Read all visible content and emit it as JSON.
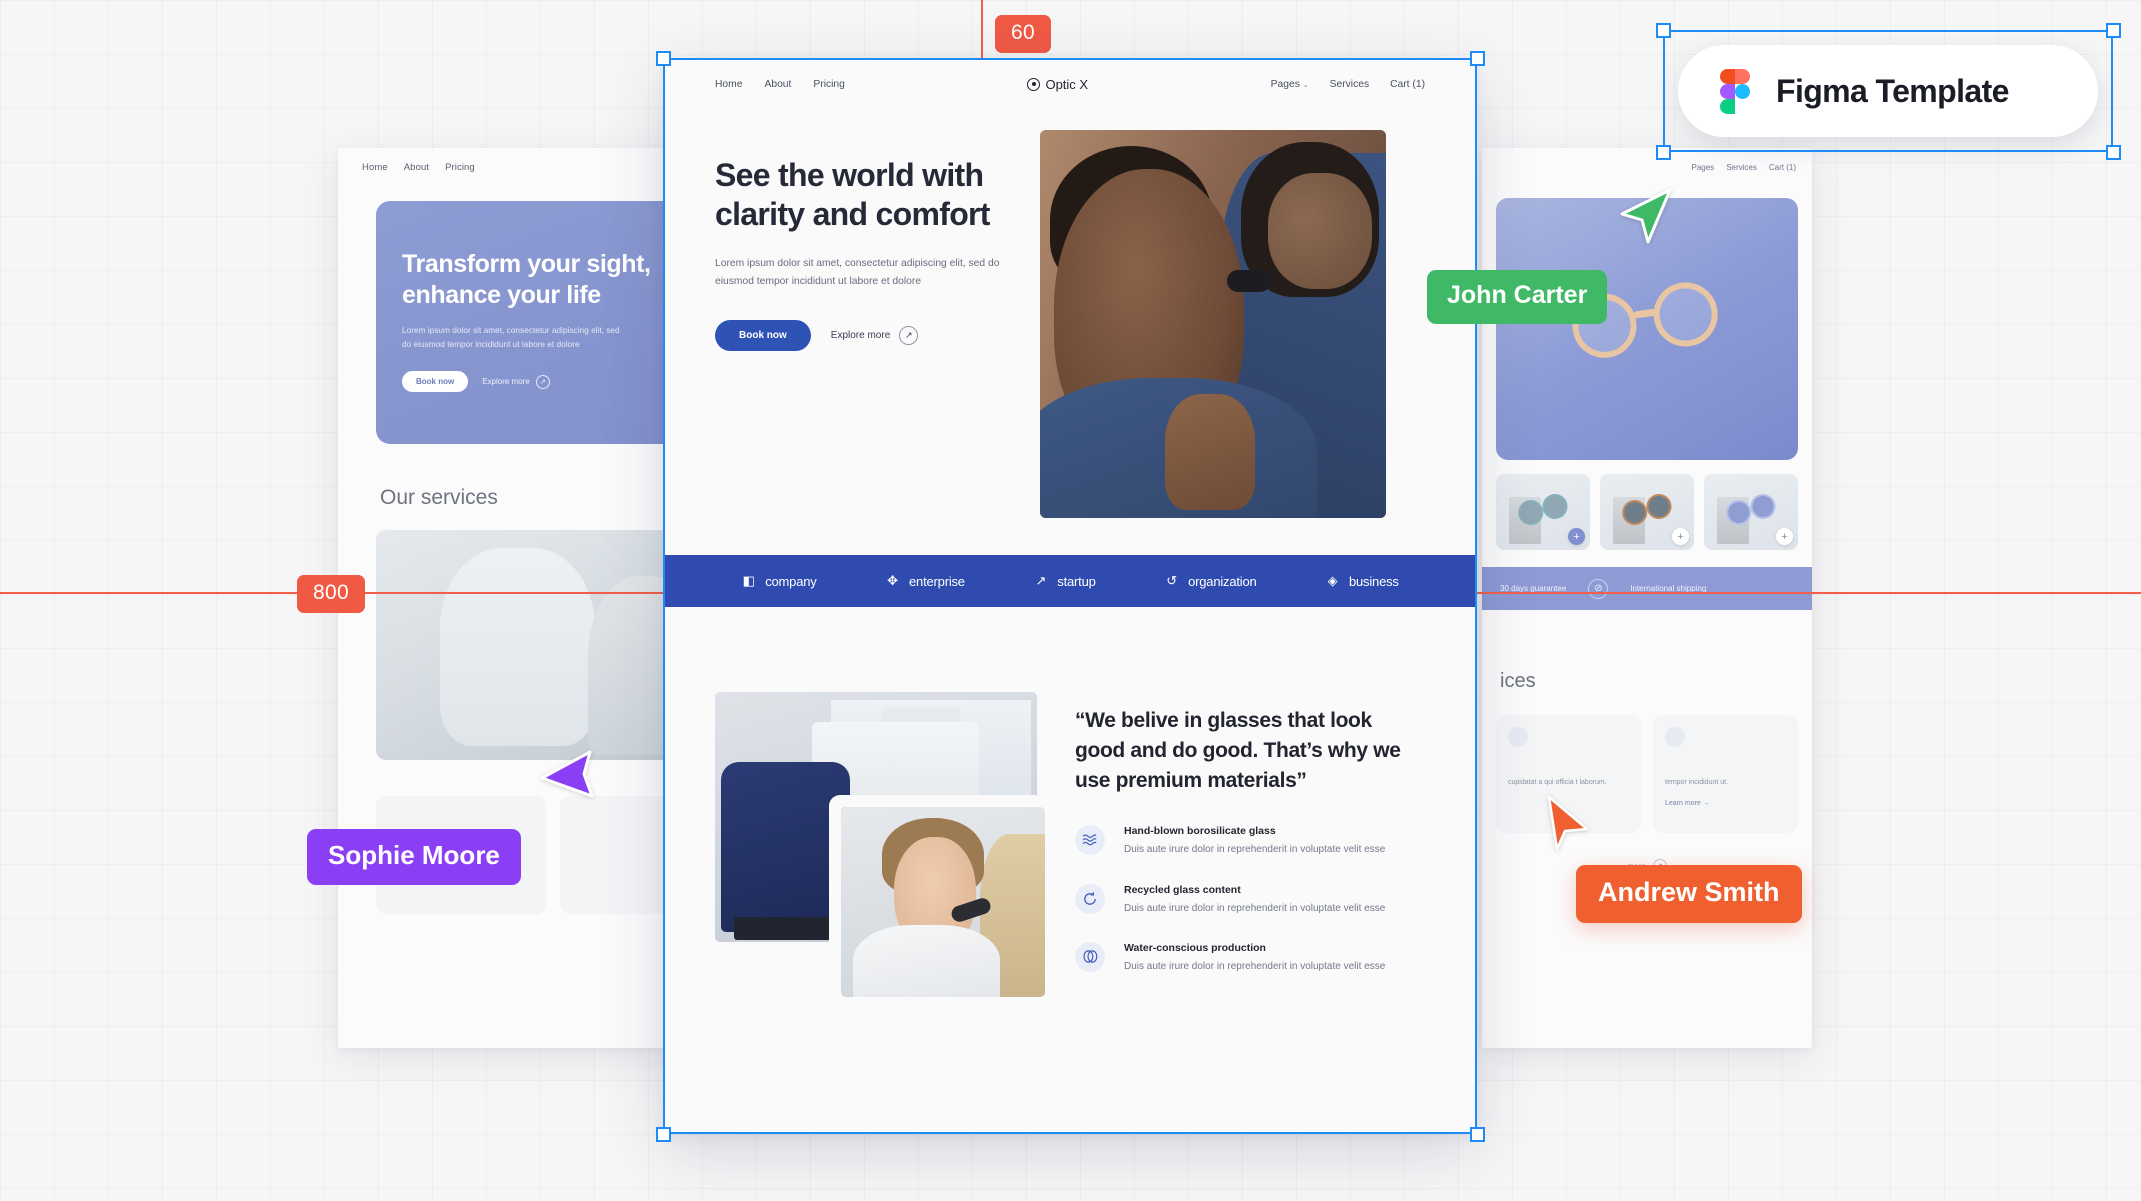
{
  "app": {
    "badge": {
      "label": "Figma Template",
      "logo_icon": "figma-logo-icon"
    }
  },
  "guides": {
    "vertical_label": "60",
    "horizontal_label": "800",
    "color": "#f05a45"
  },
  "cursors": [
    {
      "name": "John Carter",
      "color": "#3fb966",
      "icon": "cursor-arrow-icon"
    },
    {
      "name": "Sophie Moore",
      "color": "#8b3ff5",
      "icon": "cursor-arrow-icon"
    },
    {
      "name": "Andrew Smith",
      "color": "#ef5f30",
      "icon": "cursor-arrow-icon"
    }
  ],
  "main_frame": {
    "nav": {
      "left_links": [
        "Home",
        "About",
        "Pricing"
      ],
      "brand": "Optic X",
      "brand_icon": "eye-logo-icon",
      "right_links": [
        "Pages",
        "Services",
        "Cart (1)"
      ],
      "pages_chevron": "⌄"
    },
    "hero": {
      "heading": "See the world with clarity and comfort",
      "body": "Lorem ipsum dolor sit amet, consectetur adipiscing elit, sed do eiusmod tempor incididunt ut labore et dolore",
      "primary_button": "Book now",
      "secondary_link": "Explore more",
      "secondary_icon": "arrow-up-right-icon",
      "image_alt": "eye-exam-photo",
      "button_color": "#2e53b5"
    },
    "logo_strip": {
      "background": "#2f4bb0",
      "items": [
        {
          "label": "company",
          "icon": "squares-icon",
          "glyph": "◧"
        },
        {
          "label": "enterprise",
          "icon": "clover-icon",
          "glyph": "✥"
        },
        {
          "label": "startup",
          "icon": "trend-up-icon",
          "glyph": "↗"
        },
        {
          "label": "organization",
          "icon": "swirl-icon",
          "glyph": "↺"
        },
        {
          "label": "business",
          "icon": "diamond-icon",
          "glyph": "◈"
        }
      ]
    },
    "quote_section": {
      "quote": "“We belive in glasses that look good and do good. That’s why we use premium materials”",
      "image_alt_large": "optometry-equipment-photo",
      "image_alt_small": "doctor-examining-patient-photo",
      "features": [
        {
          "title": "Hand-blown borosilicate glass",
          "body": "Duis aute irure dolor in reprehenderit in voluptate velit esse",
          "icon": "waves-icon",
          "glyph": "≈"
        },
        {
          "title": "Recycled glass content",
          "body": "Duis aute irure dolor in reprehenderit in voluptate velit esse",
          "icon": "recycle-refresh-icon",
          "glyph": "↻"
        },
        {
          "title": "Water-conscious production",
          "body": "Duis aute irure dolor in reprehenderit in voluptate velit esse",
          "icon": "water-drops-icon",
          "glyph": "◑"
        }
      ]
    }
  },
  "left_frame": {
    "nav_links": [
      "Home",
      "About",
      "Pricing"
    ],
    "brand_icon": "eye-logo-icon",
    "hero": {
      "heading": "Transform your sight, enhance your life",
      "body": "Lorem ipsum dolor sit amet, consectetur adipiscing elit, sed do eiusmod tempor incididunt ut labore et dolore",
      "primary_button": "Book now",
      "secondary_link": "Explore more",
      "secondary_icon": "arrow-up-right-icon"
    },
    "services_heading": "Our services",
    "photo_alt": "eye-exam-clinic-photo"
  },
  "right_frame": {
    "nav_links": [
      "Pages",
      "Services",
      "Cart (1)"
    ],
    "hero_alt": "eyeglasses-product-photo",
    "products": [
      {
        "alt": "teal-sunglasses-tile",
        "add_icon": "plus-icon",
        "add_label": "+"
      },
      {
        "alt": "tortoise-sunglasses-tile",
        "add_icon": "plus-icon",
        "add_label": "+"
      },
      {
        "alt": "blue-sunglasses-tile",
        "add_icon": "plus-icon",
        "add_label": "+"
      }
    ],
    "strip": [
      {
        "label": "30 days guarantee",
        "icon": "shield-icon"
      },
      {
        "label": "International shipping",
        "icon": "globe-icon",
        "glyph": "⊘"
      }
    ],
    "services_heading": "ices",
    "cards": [
      {
        "body": "cupidatat a qui officia t laborum.",
        "link": ""
      },
      {
        "body": "tempor incididunt ut.",
        "link": "Learn more",
        "link_icon": "arrow-right-icon"
      }
    ],
    "more_link": "more",
    "more_icon": "arrow-up-right-icon"
  }
}
